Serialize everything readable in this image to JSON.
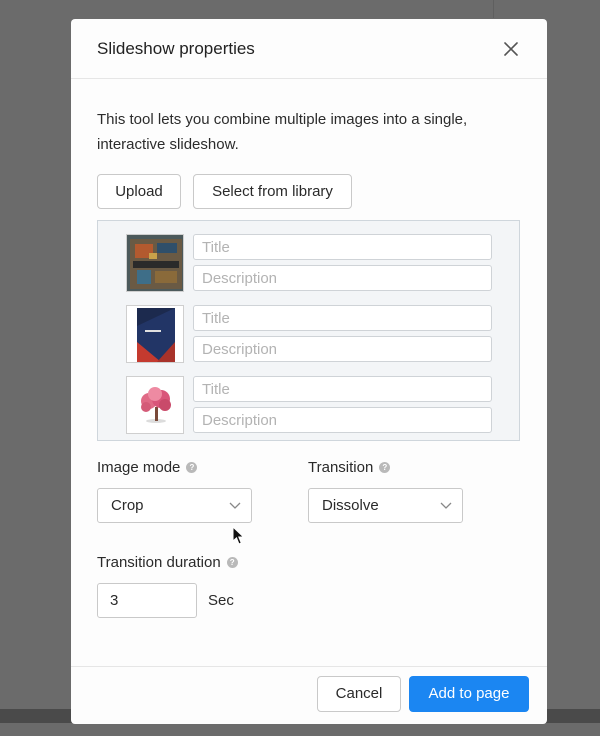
{
  "dialog": {
    "title": "Slideshow properties",
    "intro": "This tool lets you combine multiple images into a single, interactive slideshow."
  },
  "source_buttons": {
    "upload_label": "Upload",
    "library_label": "Select from library"
  },
  "images": [
    {
      "title_placeholder": "Title",
      "description_placeholder": "Description",
      "title_value": "",
      "description_value": ""
    },
    {
      "title_placeholder": "Title",
      "description_placeholder": "Description",
      "title_value": "",
      "description_value": ""
    },
    {
      "title_placeholder": "Title",
      "description_placeholder": "Description",
      "title_value": "",
      "description_value": ""
    }
  ],
  "image_mode": {
    "label": "Image mode",
    "value": "Crop"
  },
  "transition": {
    "label": "Transition",
    "value": "Dissolve"
  },
  "duration": {
    "label": "Transition duration",
    "value": "3",
    "unit": "Sec"
  },
  "footer": {
    "cancel_label": "Cancel",
    "add_label": "Add to page"
  },
  "colors": {
    "primary": "#1b86f2",
    "overlay": "#6b6b6b"
  },
  "icons": {
    "close": "close-icon",
    "help": "help-icon",
    "chevron": "chevron-down-icon"
  }
}
